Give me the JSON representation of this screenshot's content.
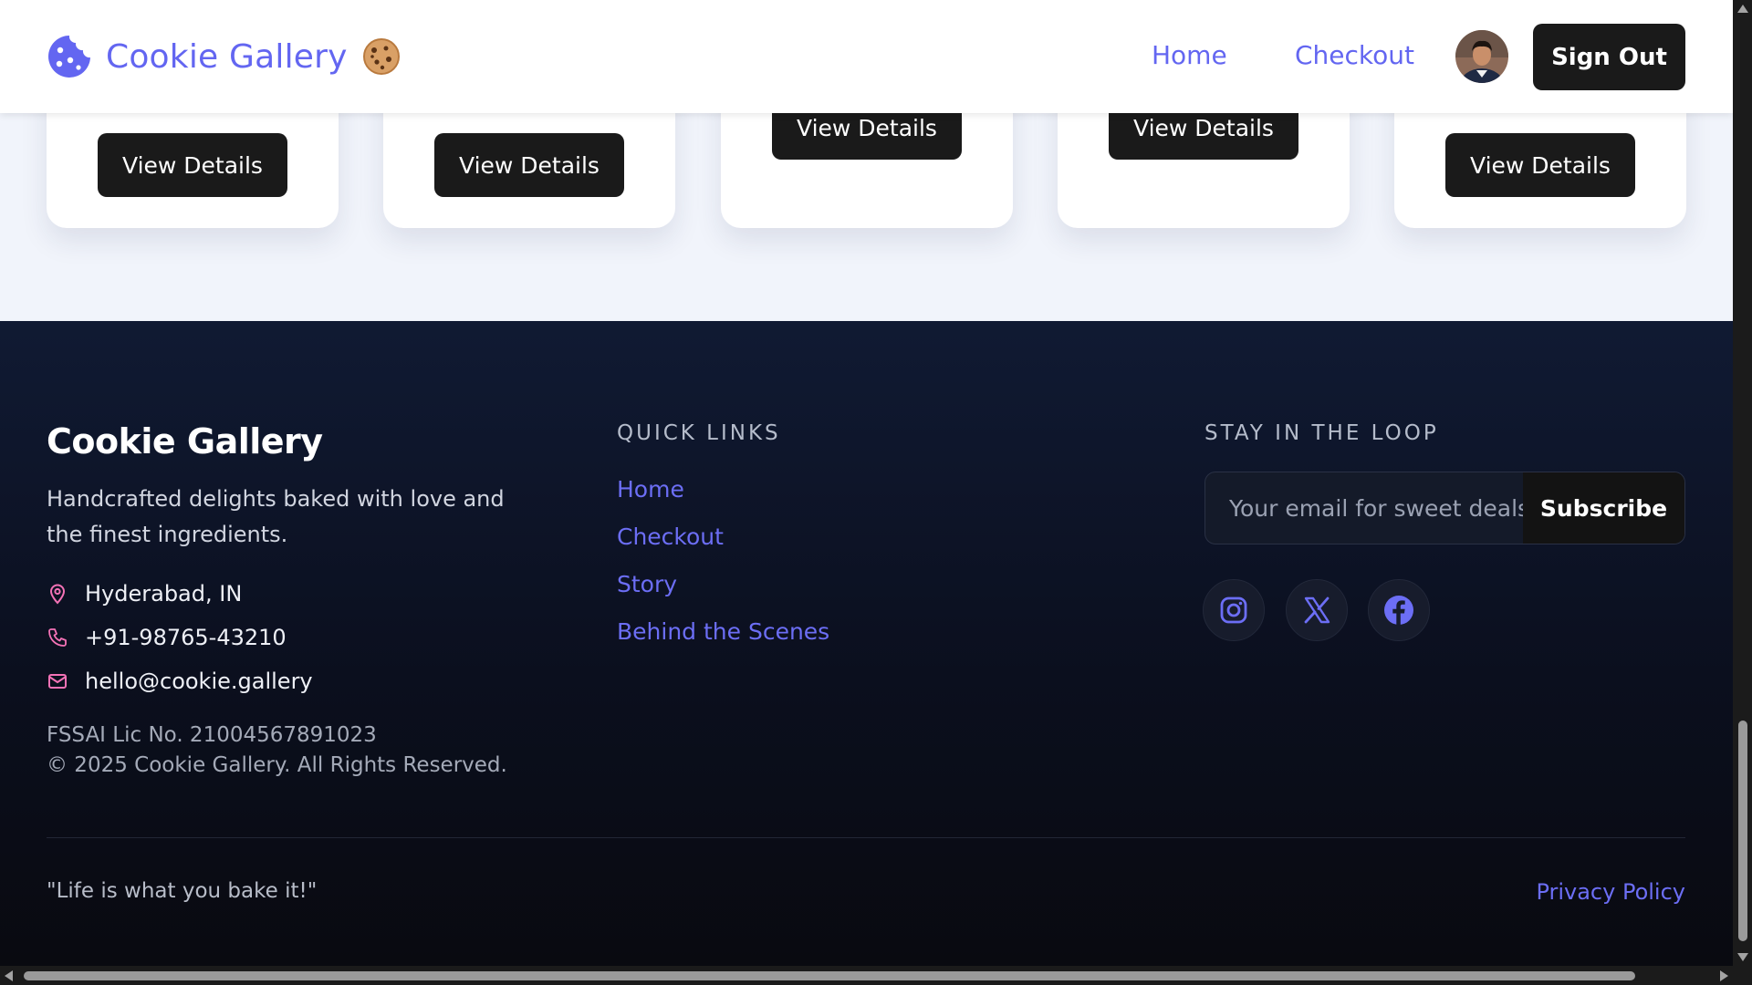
{
  "header": {
    "brand": "Cookie Gallery",
    "nav": {
      "home": "Home",
      "checkout": "Checkout"
    },
    "sign_out": "Sign Out"
  },
  "cards": [
    {
      "button": "View Details"
    },
    {
      "button": "View Details"
    },
    {
      "button": "View Details"
    },
    {
      "button": "View Details"
    },
    {
      "button": "View Details"
    }
  ],
  "footer": {
    "title": "Cookie Gallery",
    "description": "Handcrafted delights baked with love and the finest ingredients.",
    "contact": {
      "location": "Hyderabad, IN",
      "phone": "+91-98765-43210",
      "email": "hello@cookie.gallery"
    },
    "license": "FSSAI Lic No. 21004567891023",
    "copyright": "© 2025 Cookie Gallery. All Rights Reserved.",
    "quick_links": {
      "heading": "QUICK LINKS",
      "items": [
        "Home",
        "Checkout",
        "Story",
        "Behind the Scenes"
      ]
    },
    "newsletter": {
      "heading": "STAY IN THE LOOP",
      "placeholder": "Your email for sweet deals",
      "button": "Subscribe"
    },
    "social": [
      "instagram-icon",
      "x-icon",
      "facebook-icon"
    ],
    "quote": "\"Life is what you bake it!\"",
    "privacy": "Privacy Policy"
  },
  "colors": {
    "accent": "#6366f1",
    "button_dark": "#1a1a1a",
    "footer_bg": "#0b0f1e",
    "icon_pink": "#f472b6"
  }
}
